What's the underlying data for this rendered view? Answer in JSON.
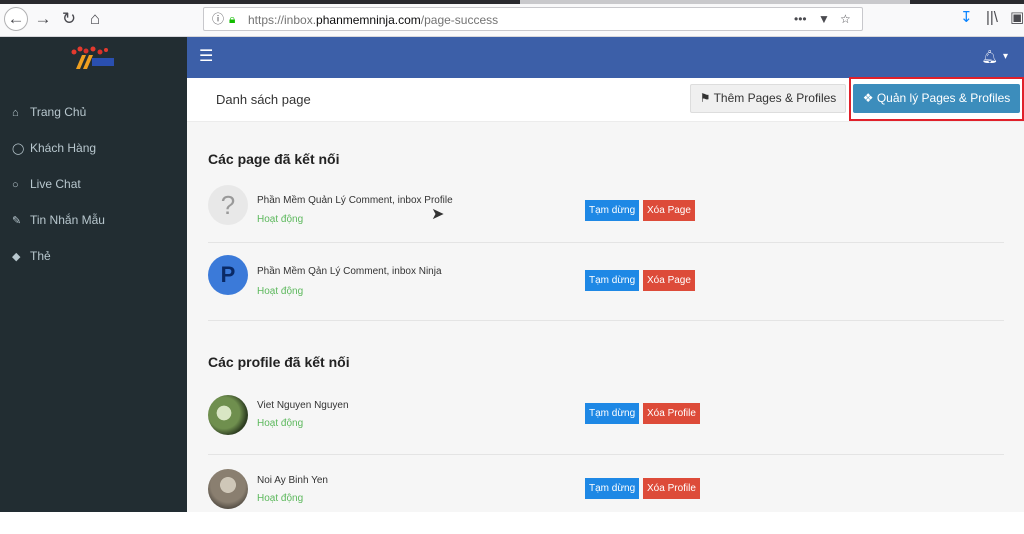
{
  "browser": {
    "url_prefix": "https://inbox.",
    "url_domain": "phanmemninja.com",
    "url_path": "/page-success"
  },
  "sidebar": {
    "items": [
      {
        "label": "Trang Chủ",
        "icon": "home-icon"
      },
      {
        "label": "Khách Hàng",
        "icon": "user-icon"
      },
      {
        "label": "Live Chat",
        "icon": "comment-icon"
      },
      {
        "label": "Tin Nhắn Mẫu",
        "icon": "paperclip-icon"
      },
      {
        "label": "Thẻ",
        "icon": "tags-icon"
      }
    ]
  },
  "header": {
    "title": "Danh sách page",
    "add_label": "Thêm Pages & Profiles",
    "manage_label": "Quản lý Pages & Profiles"
  },
  "pages": {
    "title": "Các page đã kết nối",
    "items": [
      {
        "name": "Phần Mềm Quản Lý Comment, inbox Profile",
        "status": "Hoạt động",
        "pause": "Tạm dừng",
        "delete": "Xóa Page"
      },
      {
        "name": "Phần Mềm Qản Lý Comment, inbox Ninja",
        "status": "Hoạt động",
        "pause": "Tạm dừng",
        "delete": "Xóa Page"
      }
    ]
  },
  "profiles": {
    "title": "Các profile đã kết nối",
    "items": [
      {
        "name": "Viet Nguyen Nguyen",
        "status": "Hoạt động",
        "pause": "Tạm dừng",
        "delete": "Xóa Profile"
      },
      {
        "name": "Noi Ay Binh Yen",
        "status": "Hoạt động",
        "pause": "Tạm dừng",
        "delete": "Xóa Profile"
      }
    ]
  },
  "colors": {
    "navbar": "#3c5fa8",
    "sidebar": "#222d32",
    "primary": "#3c8dbc",
    "danger": "#dd4b39",
    "success": "#5cb85c",
    "highlight": "#e0202a"
  }
}
